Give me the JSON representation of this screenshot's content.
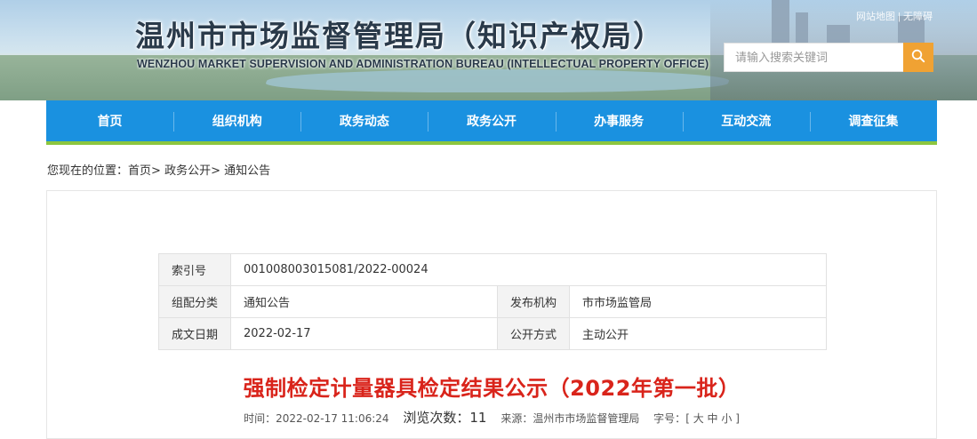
{
  "header": {
    "title": "温州市市场监督管理局（知识产权局）",
    "subtitle": "WENZHOU MARKET SUPERVISION AND ADMINISTRATION BUREAU (INTELLECTUAL PROPERTY OFFICE)",
    "top_links": "网站地图  |  无障碍",
    "search_placeholder": "请输入搜索关键词",
    "search_icon": "search-icon"
  },
  "nav": {
    "items": [
      {
        "label": "首页"
      },
      {
        "label": "组织机构"
      },
      {
        "label": "政务动态"
      },
      {
        "label": "政务公开"
      },
      {
        "label": "办事服务"
      },
      {
        "label": "互动交流"
      },
      {
        "label": "调查征集"
      }
    ]
  },
  "breadcrumb": {
    "prefix": "您现在的位置：",
    "items": [
      "首页",
      "政务公开",
      "通知公告"
    ],
    "separator": ">"
  },
  "meta": {
    "index_key": "索引号",
    "index_value": "001008003015081/2022-00024",
    "category_key": "组配分类",
    "category_value": "通知公告",
    "publisher_key": "发布机构",
    "publisher_value": "市市场监管局",
    "date_key": "成文日期",
    "date_value": "2022-02-17",
    "open_key": "公开方式",
    "open_value": "主动公开"
  },
  "article": {
    "title": "强制检定计量器具检定结果公示（2022年第一批）",
    "time_label": "时间：",
    "time_value": "2022-02-17 11:06:24",
    "views_label": "浏览次数：",
    "views_value": "11",
    "source_label": "来源：",
    "source_value": "温州市市场监督管理局",
    "fontsize_label": "字号：",
    "fontsize_open": "[",
    "fontsize_large": "大",
    "fontsize_medium": "中",
    "fontsize_small": "小",
    "fontsize_close": "]"
  },
  "colors": {
    "nav_bg": "#1a91e0",
    "nav_underline": "#8dc63f",
    "search_button": "#f0a233",
    "title_red": "#d9241b"
  }
}
